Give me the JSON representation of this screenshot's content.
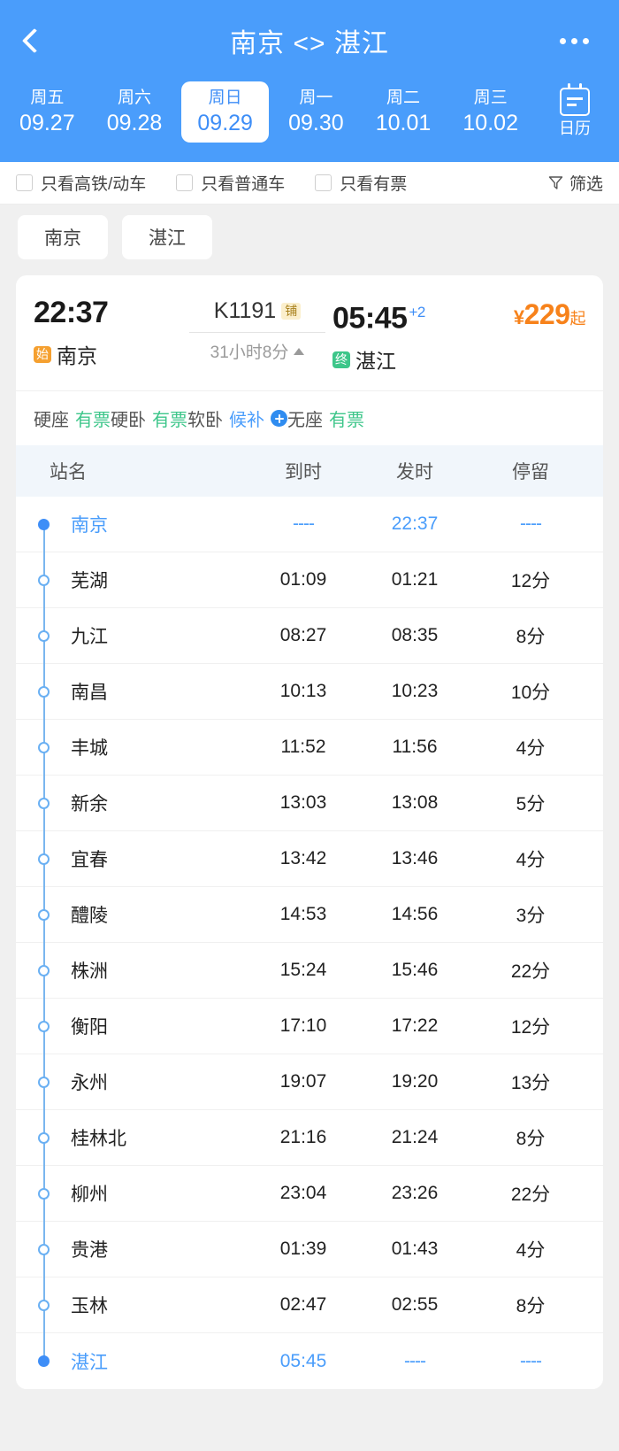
{
  "header": {
    "back_icon": "chevron-left-icon",
    "title": "南京 <> 湛江",
    "more_icon": "more-horizontal-icon",
    "dates": [
      {
        "dow": "周五",
        "date": "09.27",
        "active": false
      },
      {
        "dow": "周六",
        "date": "09.28",
        "active": false
      },
      {
        "dow": "周日",
        "date": "09.29",
        "active": true
      },
      {
        "dow": "周一",
        "date": "09.30",
        "active": false
      },
      {
        "dow": "周二",
        "date": "10.01",
        "active": false
      },
      {
        "dow": "周三",
        "date": "10.02",
        "active": false
      }
    ],
    "calendar": {
      "icon": "calendar-icon",
      "label": "日历"
    },
    "bg_color": "#4a9dfb"
  },
  "filters": {
    "checkboxes": [
      {
        "label": "只看高铁/动车",
        "checked": false
      },
      {
        "label": "只看普通车",
        "checked": false
      },
      {
        "label": "只看有票",
        "checked": false
      }
    ],
    "filter_button": {
      "label": "筛选",
      "icon": "funnel-icon"
    }
  },
  "station_tabs": [
    {
      "label": "南京"
    },
    {
      "label": "湛江"
    }
  ],
  "train": {
    "depart_time": "22:37",
    "depart_tag": "始",
    "depart_station": "南京",
    "train_number": "K1191",
    "train_badge": "铺",
    "duration": "31小时8分",
    "duration_arrow": "triangle-up-icon",
    "arrive_time": "05:45",
    "arrive_plus_days": "+2",
    "arrive_tag": "终",
    "arrive_station": "湛江",
    "price_currency": "¥",
    "price_value": "229",
    "price_suffix": "起",
    "price_color": "#f7821b",
    "seats": [
      {
        "name": "硬座",
        "status": "有票",
        "status_type": "available"
      },
      {
        "name": "硬卧",
        "status": "有票",
        "status_type": "available"
      },
      {
        "name": "软卧",
        "status": "候补",
        "status_type": "waitlist",
        "has_plus": true
      },
      {
        "name": "无座",
        "status": "有票",
        "status_type": "available"
      }
    ],
    "colors": {
      "available": "#3dc68a",
      "waitlist": "#4a9dfb",
      "start_tag": "#f5a030",
      "end_tag": "#3dc68a",
      "badge_bg": "#fbefcd",
      "badge_text": "#a8801c"
    }
  },
  "stops_table": {
    "columns": [
      "站名",
      "到时",
      "发时",
      "停留"
    ],
    "rows": [
      {
        "name": "南京",
        "arrive": "----",
        "depart": "22:37",
        "stay": "----",
        "terminal": true,
        "filled": true
      },
      {
        "name": "芜湖",
        "arrive": "01:09",
        "depart": "01:21",
        "stay": "12分",
        "terminal": false,
        "filled": false
      },
      {
        "name": "九江",
        "arrive": "08:27",
        "depart": "08:35",
        "stay": "8分",
        "terminal": false,
        "filled": false
      },
      {
        "name": "南昌",
        "arrive": "10:13",
        "depart": "10:23",
        "stay": "10分",
        "terminal": false,
        "filled": false
      },
      {
        "name": "丰城",
        "arrive": "11:52",
        "depart": "11:56",
        "stay": "4分",
        "terminal": false,
        "filled": false
      },
      {
        "name": "新余",
        "arrive": "13:03",
        "depart": "13:08",
        "stay": "5分",
        "terminal": false,
        "filled": false
      },
      {
        "name": "宜春",
        "arrive": "13:42",
        "depart": "13:46",
        "stay": "4分",
        "terminal": false,
        "filled": false
      },
      {
        "name": "醴陵",
        "arrive": "14:53",
        "depart": "14:56",
        "stay": "3分",
        "terminal": false,
        "filled": false
      },
      {
        "name": "株洲",
        "arrive": "15:24",
        "depart": "15:46",
        "stay": "22分",
        "terminal": false,
        "filled": false
      },
      {
        "name": "衡阳",
        "arrive": "17:10",
        "depart": "17:22",
        "stay": "12分",
        "terminal": false,
        "filled": false
      },
      {
        "name": "永州",
        "arrive": "19:07",
        "depart": "19:20",
        "stay": "13分",
        "terminal": false,
        "filled": false
      },
      {
        "name": "桂林北",
        "arrive": "21:16",
        "depart": "21:24",
        "stay": "8分",
        "terminal": false,
        "filled": false
      },
      {
        "name": "柳州",
        "arrive": "23:04",
        "depart": "23:26",
        "stay": "22分",
        "terminal": false,
        "filled": false
      },
      {
        "name": "贵港",
        "arrive": "01:39",
        "depart": "01:43",
        "stay": "4分",
        "terminal": false,
        "filled": false
      },
      {
        "name": "玉林",
        "arrive": "02:47",
        "depart": "02:55",
        "stay": "8分",
        "terminal": false,
        "filled": false
      },
      {
        "name": "湛江",
        "arrive": "05:45",
        "depart": "----",
        "stay": "----",
        "terminal": true,
        "filled": true
      }
    ]
  }
}
